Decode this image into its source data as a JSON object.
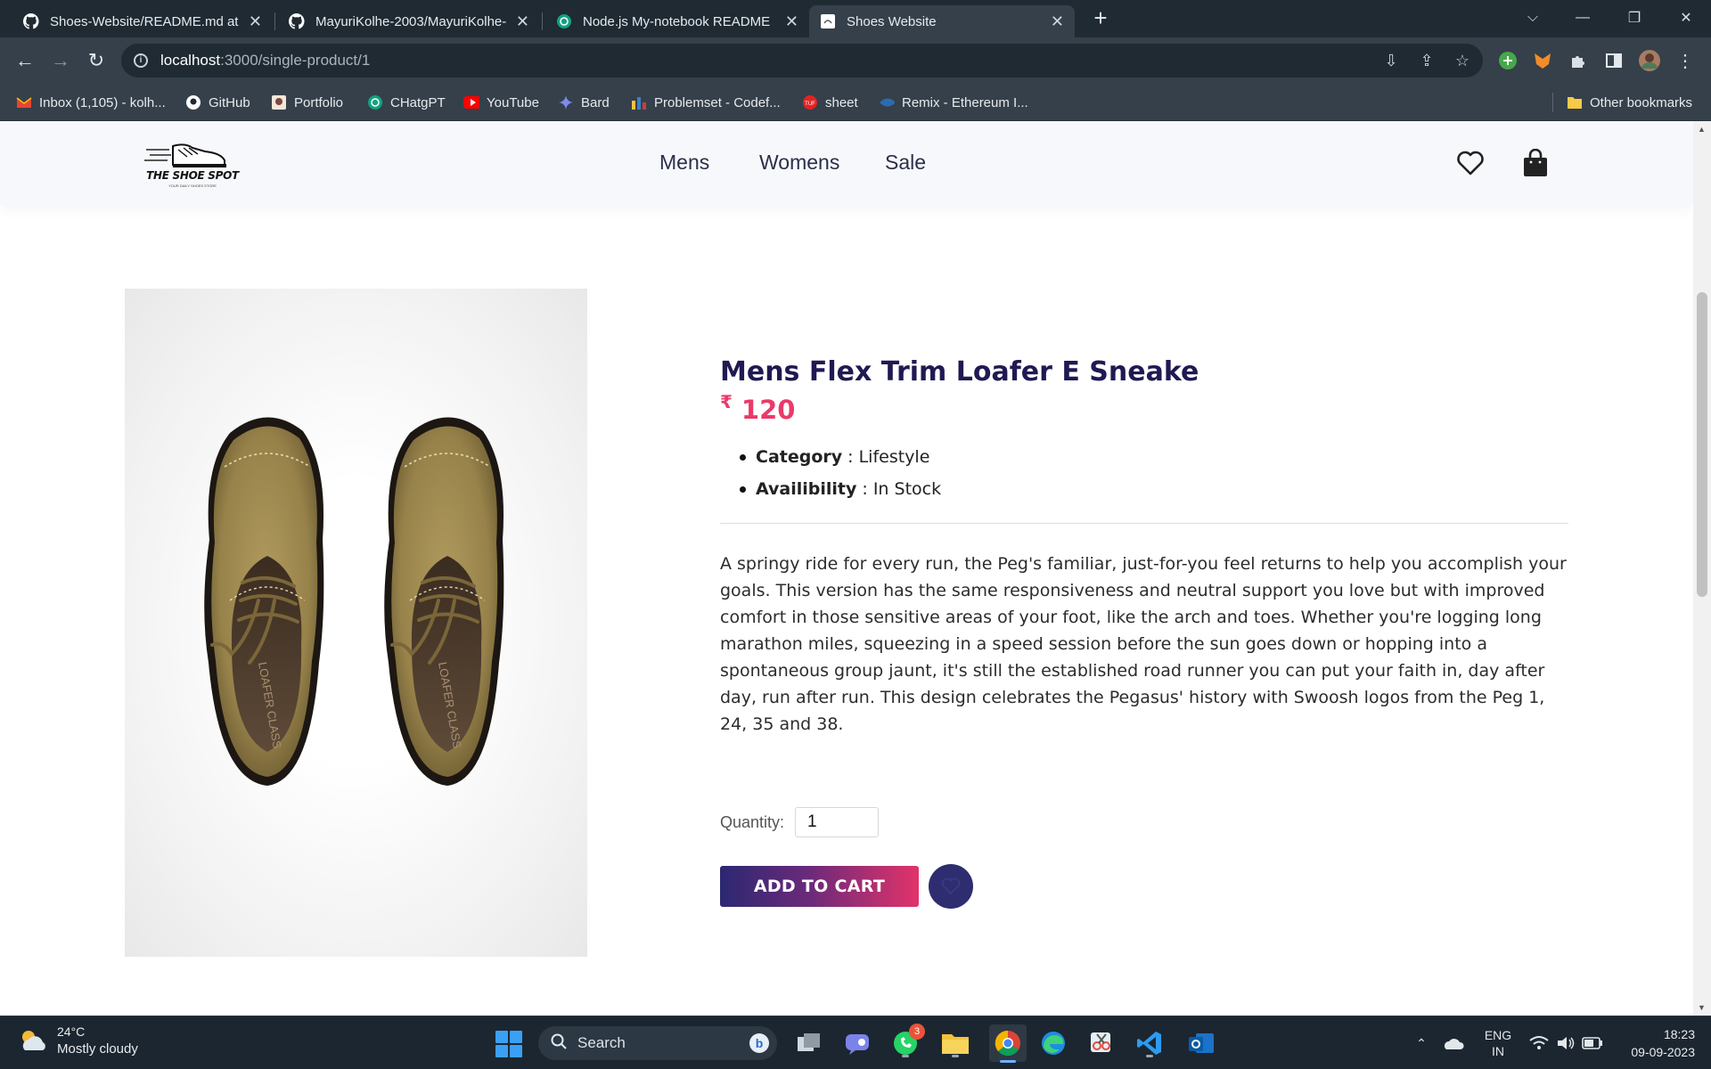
{
  "browser": {
    "tabs": [
      {
        "title": "Shoes-Website/README.md at m",
        "icon": "github-icon"
      },
      {
        "title": "MayuriKolhe-2003/MayuriKolhe-",
        "icon": "github-icon"
      },
      {
        "title": "Node.js My-notebook README",
        "icon": "chatgpt-icon"
      },
      {
        "title": "Shoes Website",
        "icon": "page-icon",
        "active": true
      }
    ],
    "url": {
      "host": "localhost",
      "path": ":3000/single-product/1"
    },
    "bookmarks": [
      {
        "label": "Inbox (1,105) - kolh...",
        "icon": "gmail-icon"
      },
      {
        "label": "GitHub",
        "icon": "github-icon"
      },
      {
        "label": "Portfolio",
        "icon": "portfolio-icon"
      },
      {
        "label": "CHatgPT",
        "icon": "chatgpt-icon"
      },
      {
        "label": "YouTube",
        "icon": "youtube-icon"
      },
      {
        "label": "Bard",
        "icon": "bard-icon"
      },
      {
        "label": "Problemset - Codef...",
        "icon": "codeforces-icon"
      },
      {
        "label": "sheet",
        "icon": "tuf-icon"
      },
      {
        "label": "Remix - Ethereum I...",
        "icon": "remix-icon"
      }
    ],
    "other_bookmarks": "Other bookmarks"
  },
  "site": {
    "logo": {
      "name": "THE SHOE SPOT",
      "tagline": "YOUR DAILY SHOES STORE"
    },
    "nav": [
      "Mens",
      "Womens",
      "Sale"
    ]
  },
  "product": {
    "title": "Mens Flex Trim Loafer E Sneake",
    "currency_symbol": "₹",
    "price": "120",
    "category_label": "Category",
    "category": ": Lifestyle",
    "availability_label": "Availibility",
    "availability": ": In Stock",
    "description": "A springy ride for every run, the Peg's familiar, just-for-you feel returns to help you accomplish your goals. This version has the same responsiveness and neutral support you love but with improved comfort in those sensitive areas of your foot, like the arch and toes. Whether you're logging long marathon miles, squeezing in a speed session before the sun goes down or hopping into a spontaneous group jaunt, it's still the established road runner you can put your faith in, day after day, run after run. This design celebrates the Pegasus' history with Swoosh logos from the Peg 1, 24, 35 and 38.",
    "quantity_label": "Quantity:",
    "quantity": "1",
    "add_to_cart": "ADD TO CART",
    "image_label": "LOAFER CLASS"
  },
  "taskbar": {
    "weather": {
      "temp": "24°C",
      "condition": "Mostly cloudy"
    },
    "search_placeholder": "Search",
    "whatsapp_badge": "3",
    "lang_line1": "ENG",
    "lang_line2": "IN",
    "time": "18:23",
    "date": "09-09-2023"
  },
  "colors": {
    "accent_pink": "#ea3a6a",
    "title_navy": "#1f1a52",
    "button_navy": "#2e2d70"
  }
}
